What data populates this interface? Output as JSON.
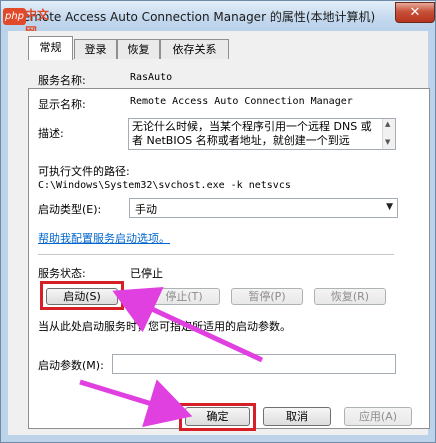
{
  "window": {
    "title": "Remote Access Auto Connection Manager 的属性(本地计算机)",
    "close_glyph": "✕",
    "watermark": "php中文网"
  },
  "tabs": [
    {
      "label": "常规",
      "active": true
    },
    {
      "label": "登录",
      "active": false
    },
    {
      "label": "恢复",
      "active": false
    },
    {
      "label": "依存关系",
      "active": false
    }
  ],
  "general": {
    "service_name_label": "服务名称:",
    "service_name": "RasAuto",
    "display_name_label": "显示名称:",
    "display_name": "Remote Access Auto Connection Manager",
    "description_label": "描述:",
    "description": "无论什么时候，当某个程序引用一个远程 DNS 或者 NetBIOS 名称或者地址，就创建一个到远",
    "exe_path_label": "可执行文件的路径:",
    "exe_path": "C:\\Windows\\System32\\svchost.exe -k netsvcs",
    "startup_type_label": "启动类型(E):",
    "startup_type_value": "手动",
    "help_link": "帮助我配置服务启动选项。",
    "status_label": "服务状态:",
    "status_value": "已停止",
    "start_button": "启动(S)",
    "stop_button": "停止(T)",
    "pause_button": "暂停(P)",
    "resume_button": "恢复(R)",
    "hint": "当从此处启动服务时，您可指定所适用的启动参数。",
    "params_label": "启动参数(M):",
    "params_value": ""
  },
  "footer": {
    "ok_button": "确定",
    "cancel_button": "取消",
    "apply_button": "应用(A)"
  },
  "colors": {
    "annotation_arrow": "#e040e0",
    "highlight_box": "#d61f26",
    "link": "#0066cc"
  }
}
